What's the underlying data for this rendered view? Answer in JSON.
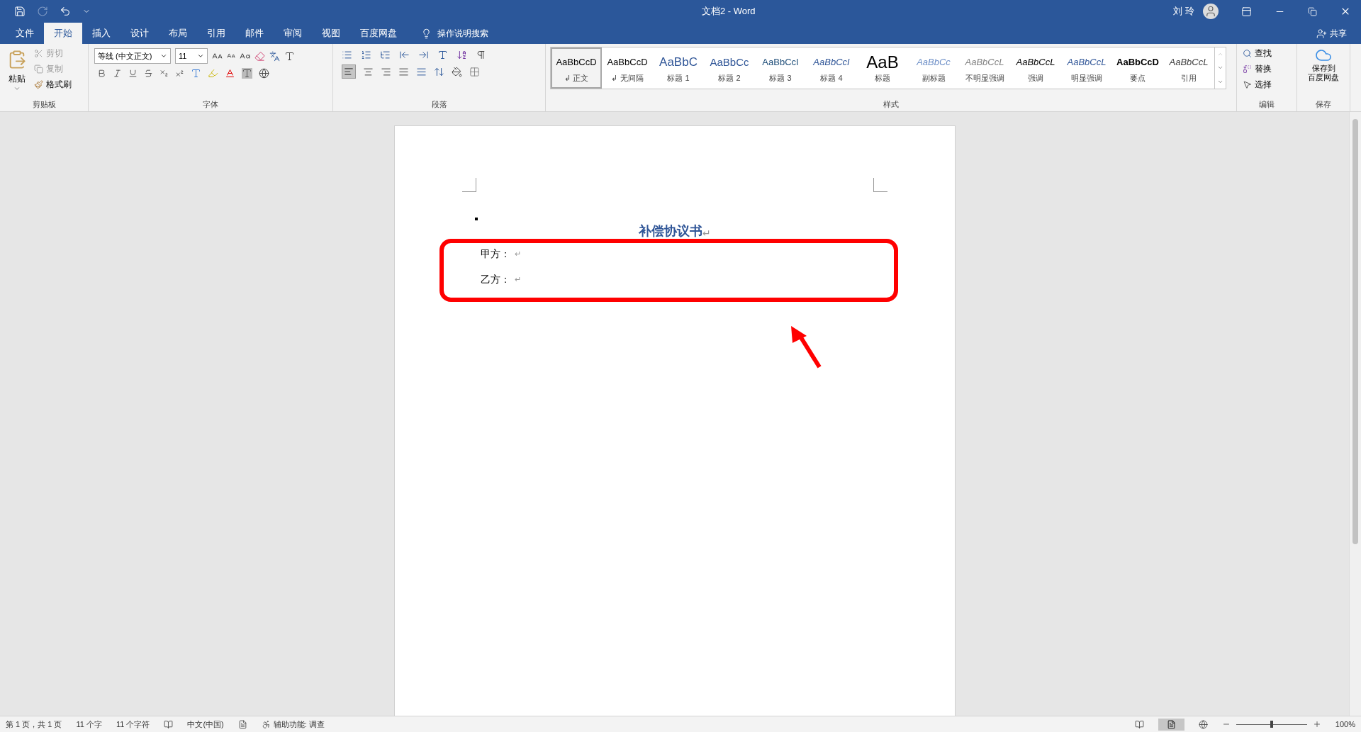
{
  "window": {
    "title": "文档2 - Word",
    "user": "刘 玲",
    "share": "共享"
  },
  "tabs": [
    {
      "label": "文件",
      "selected": false
    },
    {
      "label": "开始",
      "selected": true
    },
    {
      "label": "插入",
      "selected": false
    },
    {
      "label": "设计",
      "selected": false
    },
    {
      "label": "布局",
      "selected": false
    },
    {
      "label": "引用",
      "selected": false
    },
    {
      "label": "邮件",
      "selected": false
    },
    {
      "label": "审阅",
      "selected": false
    },
    {
      "label": "视图",
      "selected": false
    },
    {
      "label": "百度网盘",
      "selected": false
    }
  ],
  "tell_me": "操作说明搜索",
  "clipboard": {
    "paste": "粘贴",
    "cut": "剪切",
    "copy": "复制",
    "format_painter": "格式刷",
    "label": "剪贴板"
  },
  "font": {
    "name": "等线 (中文正文)",
    "size": "11",
    "label": "字体"
  },
  "paragraph": {
    "label": "段落"
  },
  "styles": {
    "label": "样式",
    "items": [
      {
        "sample": "AaBbCcD",
        "label": "↲ 正文",
        "kind": "normal",
        "selected": true
      },
      {
        "sample": "AaBbCcD",
        "label": "↲ 无间隔",
        "kind": "normal",
        "selected": false
      },
      {
        "sample": "AaBbC",
        "label": "标题 1",
        "kind": "heading1",
        "selected": false
      },
      {
        "sample": "AaBbCc",
        "label": "标题 2",
        "kind": "heading2",
        "selected": false
      },
      {
        "sample": "AaBbCcI",
        "label": "标题 3",
        "kind": "heading3",
        "selected": false
      },
      {
        "sample": "AaBbCcI",
        "label": "标题 4",
        "kind": "heading4",
        "selected": false
      },
      {
        "sample": "AaB",
        "label": "标题",
        "kind": "title",
        "selected": false
      },
      {
        "sample": "AaBbCc",
        "label": "副标题",
        "kind": "subtitle",
        "selected": false
      },
      {
        "sample": "AaBbCcL",
        "label": "不明显强调",
        "kind": "subtle",
        "selected": false
      },
      {
        "sample": "AaBbCcL",
        "label": "强调",
        "kind": "emphasis",
        "selected": false
      },
      {
        "sample": "AaBbCcL",
        "label": "明显强调",
        "kind": "intense",
        "selected": false
      },
      {
        "sample": "AaBbCcD",
        "label": "要点",
        "kind": "strong",
        "selected": false
      },
      {
        "sample": "AaBbCcL",
        "label": "引用",
        "kind": "quote",
        "selected": false
      }
    ]
  },
  "editing": {
    "find": "查找",
    "replace": "替换",
    "select": "选择",
    "label": "编辑"
  },
  "save": {
    "lines": [
      "保存到",
      "百度网盘"
    ],
    "label": "保存"
  },
  "document": {
    "title": {
      "text": "补偿协议书",
      "mark": "↵"
    },
    "lines": [
      {
        "text": "甲方：",
        "mark": "↵"
      },
      {
        "text": "乙方：",
        "mark": "↵"
      }
    ]
  },
  "status_bar": {
    "page": "第 1 页，共 1 页",
    "words": "11 个字",
    "chars": "11 个字符",
    "language": "中文(中国)",
    "accessibility": "辅助功能: 调查",
    "zoom": "100%",
    "zoom_level": {
      "level": 0.5
    }
  }
}
